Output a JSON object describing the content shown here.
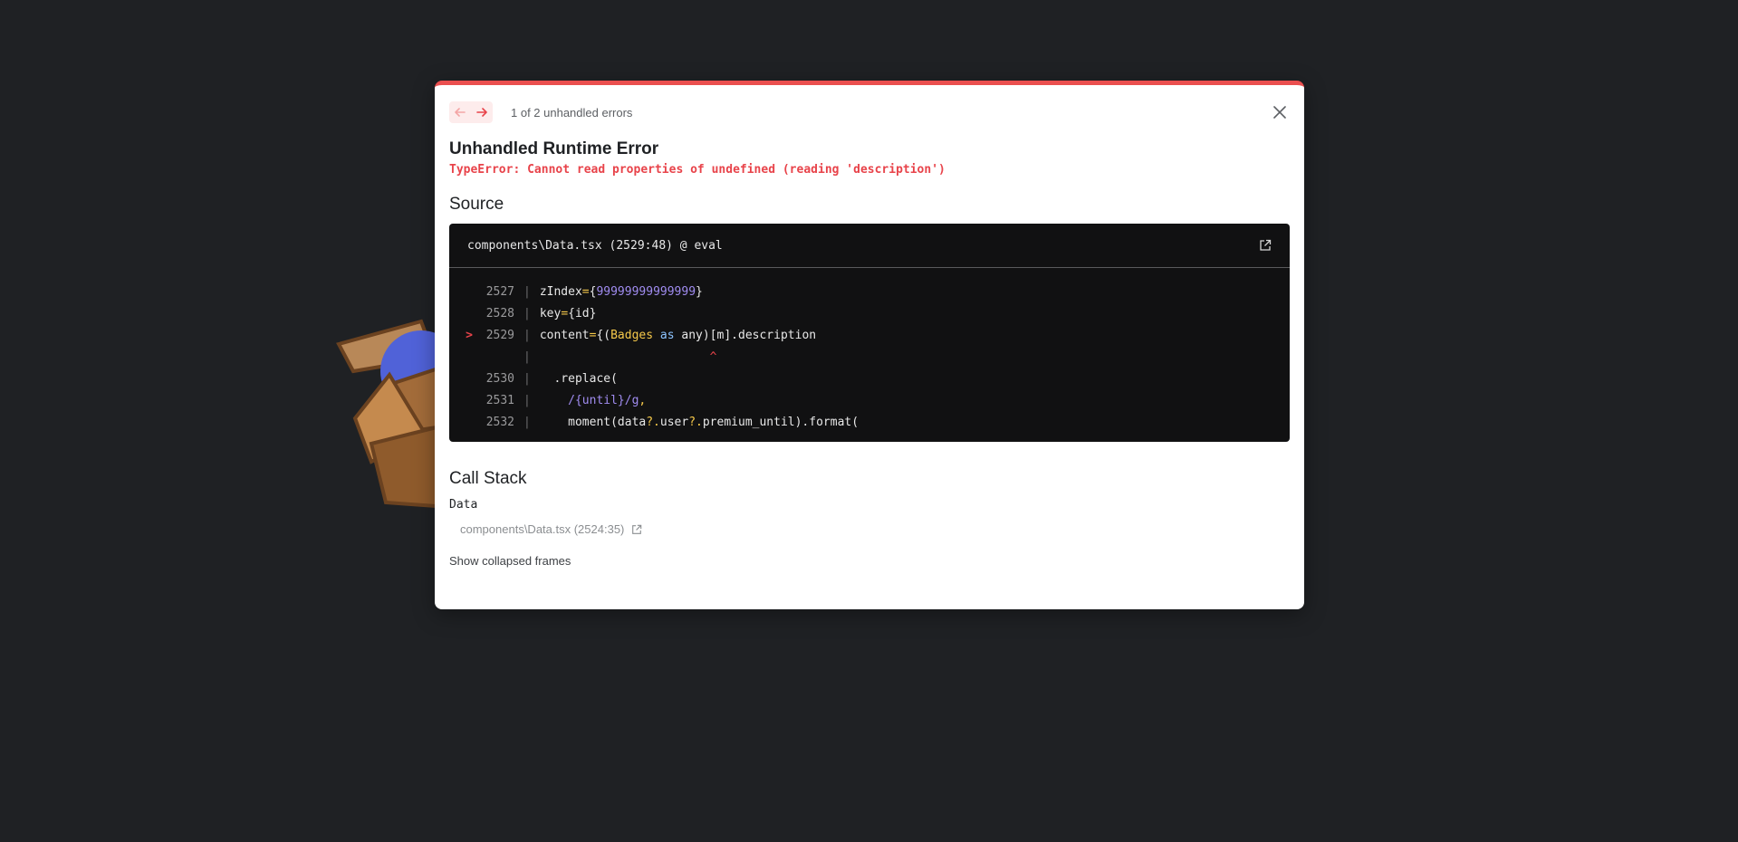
{
  "error_overlay": {
    "counter_text": "1 of 2 unhandled errors",
    "title": "Unhandled Runtime Error",
    "message": "TypeError: Cannot read properties of undefined (reading 'description')",
    "source_heading": "Source",
    "source_file": "components\\Data.tsx (2529:48) @ eval",
    "code_lines": [
      {
        "marker": "",
        "num": "2527",
        "text": "zIndex={99999999999999}"
      },
      {
        "marker": "",
        "num": "2528",
        "text": "key={id}"
      },
      {
        "marker": ">",
        "num": "2529",
        "text": "content={(Badges as any)[m].description"
      },
      {
        "marker": "",
        "num": "",
        "text": "                        ^"
      },
      {
        "marker": "",
        "num": "2530",
        "text": "  .replace("
      },
      {
        "marker": "",
        "num": "2531",
        "text": "    /{until}/g,"
      },
      {
        "marker": "",
        "num": "2532",
        "text": "    moment(data?.user?.premium_until).format("
      }
    ],
    "callstack_heading": "Call Stack",
    "callstack_frames": [
      {
        "function": "Data",
        "location": "components\\Data.tsx (2524:35)"
      }
    ],
    "show_collapsed_label": "Show collapsed frames",
    "accent_color": "#ea4f4f"
  }
}
